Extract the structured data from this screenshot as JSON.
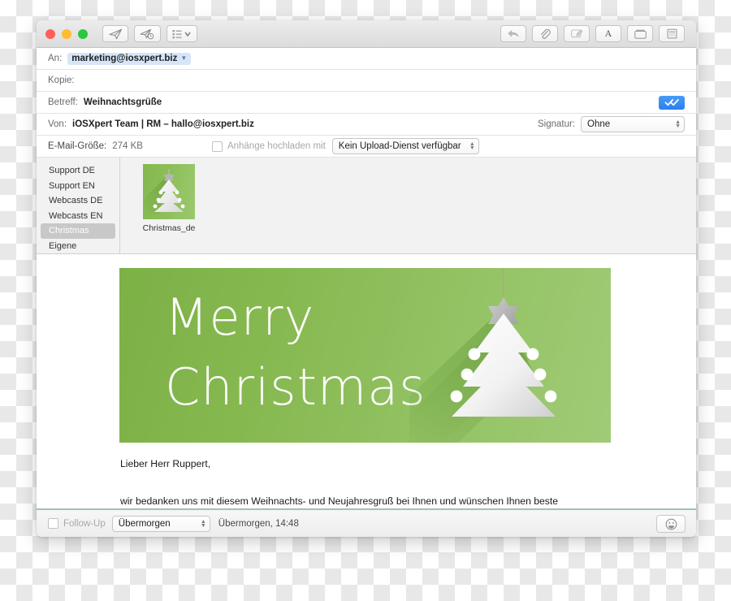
{
  "window": {
    "traffic_lights": [
      "close",
      "minimize",
      "zoom"
    ],
    "toolbar_left": [
      {
        "name": "send-button",
        "icon": "paper-plane-icon"
      },
      {
        "name": "send-later-button",
        "icon": "paper-plane-clock-icon"
      },
      {
        "name": "templates-button",
        "icon": "list-chevron-icon"
      }
    ],
    "toolbar_right": [
      {
        "name": "reply-button",
        "icon": "reply-arrow-icon"
      },
      {
        "name": "attach-button",
        "icon": "paperclip-icon"
      },
      {
        "name": "markup-button",
        "icon": "markup-image-icon"
      },
      {
        "name": "format-button",
        "icon": "letter-a-icon",
        "label": "A"
      },
      {
        "name": "photo-browser-button",
        "icon": "window-icon"
      },
      {
        "name": "stationery-button",
        "icon": "stationery-icon"
      }
    ]
  },
  "header": {
    "to": {
      "label": "An:",
      "recipient": "marketing@iosxpert.biz"
    },
    "cc": {
      "label": "Kopie:",
      "value": ""
    },
    "subject": {
      "label": "Betreff:",
      "value": "Weihnachtsgrüße"
    },
    "from": {
      "label": "Von:",
      "value": "iOSXpert Team | RM – hallo@iosxpert.biz"
    },
    "signature": {
      "label": "Signatur:",
      "value": "Ohne"
    },
    "size": {
      "label": "E-Mail-Größe:",
      "value": "274 KB"
    },
    "upload": {
      "checkbox_label": "Anhänge hochladen mit",
      "checked": false,
      "service": "Kein Upload-Dienst verfügbar"
    },
    "tracking_button": "double-check-icon"
  },
  "templates": {
    "categories": [
      {
        "label": "Support DE",
        "selected": false
      },
      {
        "label": "Support EN",
        "selected": false
      },
      {
        "label": "Webcasts DE",
        "selected": false
      },
      {
        "label": "Webcasts EN",
        "selected": false
      },
      {
        "label": "Christmas",
        "selected": true
      },
      {
        "label": "Eigene",
        "selected": false
      }
    ],
    "items": [
      {
        "label": "Christmas_de"
      }
    ]
  },
  "message": {
    "banner": {
      "title": "Merry\nChristmas",
      "bg_color_left": "#7cb146",
      "bg_color_right": "#a0cb77",
      "graphic": "christmas-tree-illustration"
    },
    "salutation": "Lieber Herr Ruppert,",
    "paragraph": "wir bedanken uns mit diesem Weihnachts- und Neujahresgruß bei Ihnen und wünschen Ihnen beste Gesundheit, viel Glück, ein schönes neues Jahr sowie eine besinnliche Weihnachtszeit. Viel Erfolg im"
  },
  "footer": {
    "follow_up": {
      "label": "Follow-Up",
      "checked": false
    },
    "follow_up_when": "Übermorgen",
    "follow_up_date": "Übermorgen, 14:48",
    "emoji_button": "smiley-icon"
  }
}
